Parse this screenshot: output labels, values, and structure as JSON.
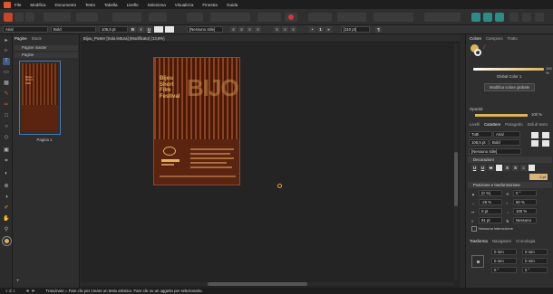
{
  "menubar": {
    "items": [
      "File",
      "Modifica",
      "Documento",
      "Testo",
      "Tabella",
      "Livello",
      "Seleziona",
      "Visualizza",
      "Finestra",
      "Guida"
    ]
  },
  "context_toolbar": {
    "font": "Arial",
    "style": "Bold",
    "size": "106,5 pt",
    "bold": "B",
    "italic": "I",
    "underline": "U",
    "paragraph_style": "[Nessuno stile]",
    "tracking": "[110 pt]"
  },
  "document": {
    "tab_title": "Bijou_Poster [Sola lettura] (Modificato) (13,6%)"
  },
  "pages_panel": {
    "tabs": [
      "Pagine",
      "Stock"
    ],
    "sections": [
      "Pagine master",
      "Pagine"
    ],
    "page_label": "Pagina 1"
  },
  "poster": {
    "title_lines": [
      "Bijou",
      "Short",
      "Film",
      "Festival"
    ],
    "big_letters": "BIJOU"
  },
  "right_panel": {
    "color_tabs": [
      "Colore",
      "Campioni",
      "Tratto"
    ],
    "color_name": "Global Color 1",
    "global_button": "Modifica colore globale",
    "opacity_label": "Opacità",
    "opacity_value": "100 %",
    "opacity_value2": "100 %",
    "text_tabs": [
      "Livelli",
      "Carattere",
      "Paragrafo",
      "Stili di testo"
    ],
    "font_filter": "Tutti",
    "font_name": "Arial",
    "font_size": "106,5 pt",
    "font_style": "Bold",
    "font_label2": "[Nessuno stile]",
    "decorations_header": "Decorazioni",
    "deco_value": ".2 pt",
    "position_header": "Posizione e trasformazione",
    "pos_rows": [
      [
        "(0 %)",
        "0 °"
      ],
      [
        "-25 %",
        "50 %"
      ],
      [
        "0 pt",
        "100 %"
      ],
      [
        "91 pt",
        "Nessuno"
      ]
    ],
    "no_break": "Nessuna interruzione",
    "transform_tabs": [
      "Trasforma",
      "Navigatore",
      "Cronologia"
    ],
    "transform_vals": [
      "0 mm",
      "0 mm",
      "0 mm",
      "0 mm",
      "0 °",
      "0 °"
    ]
  },
  "status": {
    "page_counter": "1 di 1",
    "hint": "Trascinare = Fare clic per creare un testo artistico. Fare clic su un oggetto per selezionarlo."
  },
  "colors": {
    "accent": "#e8542a",
    "poster_bg": "#5b2410",
    "poster_text": "#e4b35c",
    "swatch": "#d8b47a"
  }
}
